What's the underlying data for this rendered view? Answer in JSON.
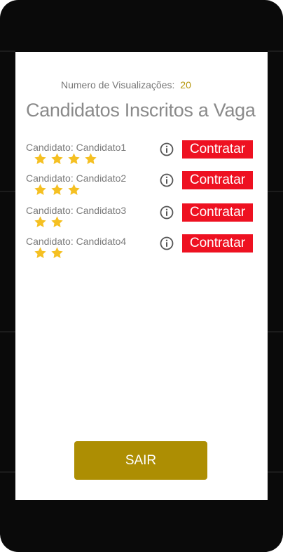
{
  "header": {
    "views_label": "Numero de Visualizações:",
    "views_count": "20",
    "title": "Candidatos Inscritos a Vaga"
  },
  "candidates": [
    {
      "label": "Candidato: Candidato1",
      "rating": 4,
      "hire_label": "Contratar"
    },
    {
      "label": "Candidato: Candidato2",
      "rating": 3,
      "hire_label": "Contratar"
    },
    {
      "label": "Candidato: Candidato3",
      "rating": 2,
      "hire_label": "Contratar"
    },
    {
      "label": "Candidato: Candidato4",
      "rating": 2,
      "hire_label": "Contratar"
    }
  ],
  "footer": {
    "exit_label": "SAIR"
  },
  "icons": {
    "star": "star-icon",
    "info": "info-icon"
  },
  "colors": {
    "accent_gold": "#ad8e03",
    "views_count": "#b5960a",
    "star": "#f5c022",
    "hire_button": "#ee1121"
  }
}
